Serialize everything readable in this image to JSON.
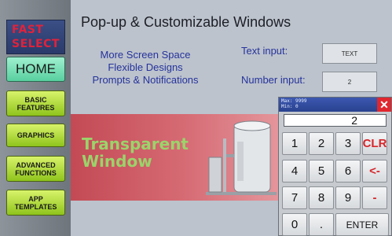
{
  "sidebar": {
    "logo": {
      "line1": "FAST",
      "line2": "SELECT"
    },
    "items": [
      {
        "label": "HOME"
      },
      {
        "label": "BASIC FEATURES"
      },
      {
        "label": "GRAPHICS"
      },
      {
        "label": "ADVANCED FUNCTIONS"
      },
      {
        "label": "APP TEMPLATES"
      }
    ]
  },
  "main": {
    "title": "Pop-up & Customizable Windows",
    "features": [
      "More Screen Space",
      "Flexible Designs",
      "Prompts & Notifications"
    ],
    "text_input": {
      "label": "Text input:",
      "value": "TEXT"
    },
    "number_input": {
      "label": "Number input:",
      "value": "2"
    },
    "banner": {
      "line1": "Transparent",
      "line2": "Window"
    }
  },
  "keypad": {
    "max_label": "Max: 9999",
    "min_label": "Min: 0",
    "display": "2",
    "keys": [
      [
        "1",
        "2",
        "3",
        "CLR"
      ],
      [
        "4",
        "5",
        "6",
        "<-"
      ],
      [
        "7",
        "8",
        "9",
        "-"
      ],
      [
        "0",
        ".",
        "ENTER"
      ]
    ]
  },
  "colors": {
    "accent_blue": "#26339c",
    "home_button": "#58cf9f",
    "nav_button": "#8fc41c",
    "banner": "#c34a55",
    "keypad_header": "#2a428f",
    "close_red": "#e0262e"
  },
  "icons": [
    "close-icon",
    "tank-illustration"
  ]
}
